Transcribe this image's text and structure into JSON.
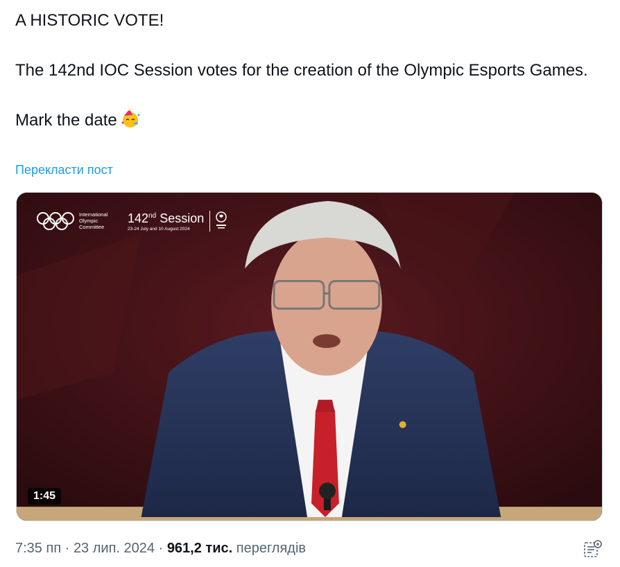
{
  "tweet": {
    "line1": "A HISTORIC VOTE!",
    "line2": "The 142nd IOC Session votes for the creation of the Olympic Esports Games.",
    "line3": "Mark the date",
    "emoji": "party-face"
  },
  "translate_label": "Перекласти пост",
  "video": {
    "ioc_name": "International Olympic Committee",
    "ioc_line1": "International",
    "ioc_line2": "Olympic",
    "ioc_line3": "Committee",
    "session_number": "142",
    "session_suffix": "nd",
    "session_word": "Session",
    "session_dates": "23-24 July and 10 August 2024",
    "paris_logo_text": "PARIS 2024",
    "duration": "1:45"
  },
  "meta": {
    "time": "7:35 пп",
    "separator1": " · ",
    "date": "23 лип. 2024",
    "separator2": " · ",
    "views": "961,2 тис.",
    "views_label": "переглядів"
  },
  "icons": {
    "analytics": "analytics-icon"
  }
}
